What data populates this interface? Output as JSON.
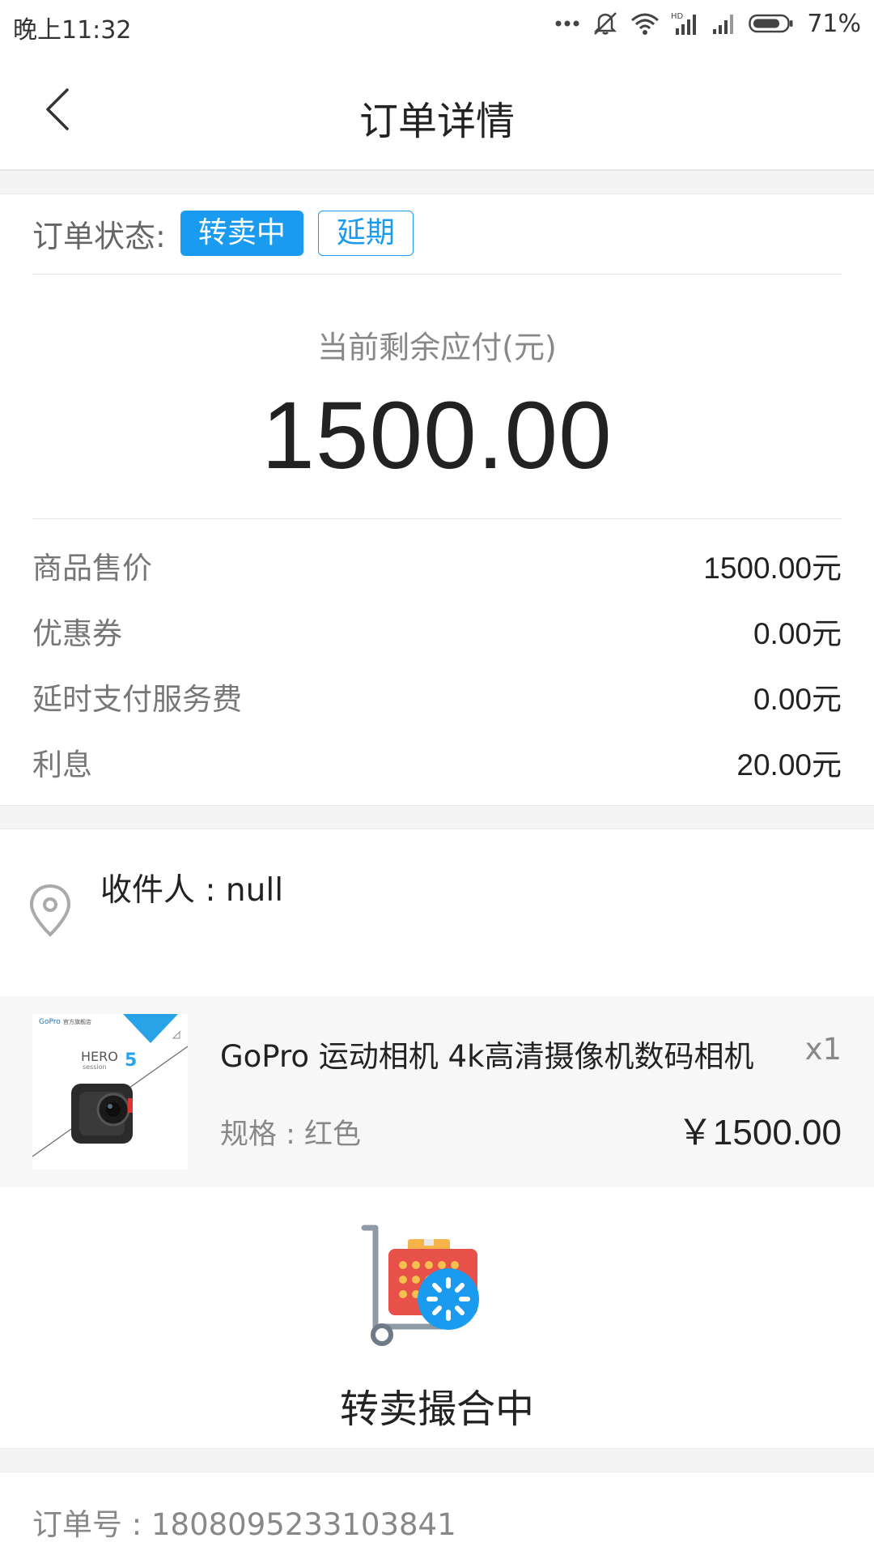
{
  "status_bar": {
    "time": "晚上11:32",
    "battery": "71%"
  },
  "header": {
    "title": "订单详情"
  },
  "order_status": {
    "label": "订单状态:",
    "badges": [
      "转卖中",
      "延期"
    ]
  },
  "remaining": {
    "label": "当前剩余应付(元)",
    "amount": "1500.00"
  },
  "fees": [
    {
      "name": "商品售价",
      "value": "1500.00元"
    },
    {
      "name": "优惠券",
      "value": "0.00元"
    },
    {
      "name": "延时支付服务费",
      "value": "0.00元"
    },
    {
      "name": "利息",
      "value": "20.00元"
    }
  ],
  "address": {
    "recipient": "收件人 : null"
  },
  "product": {
    "name": "GoPro 运动相机 4k高清摄像机数码相机",
    "quantity": "x1",
    "spec": "规格 : 红色",
    "price": "￥1500.00",
    "thumb_brand": "GoPro",
    "thumb_store": "官方旗舰店",
    "thumb_model": "HERO",
    "thumb_model_num": "5",
    "thumb_sub": "session"
  },
  "matching": {
    "text": "转卖撮合中"
  },
  "order": {
    "number_label": "订单号 : 1808095233103841"
  },
  "colors": {
    "accent": "#1a9bf0"
  }
}
